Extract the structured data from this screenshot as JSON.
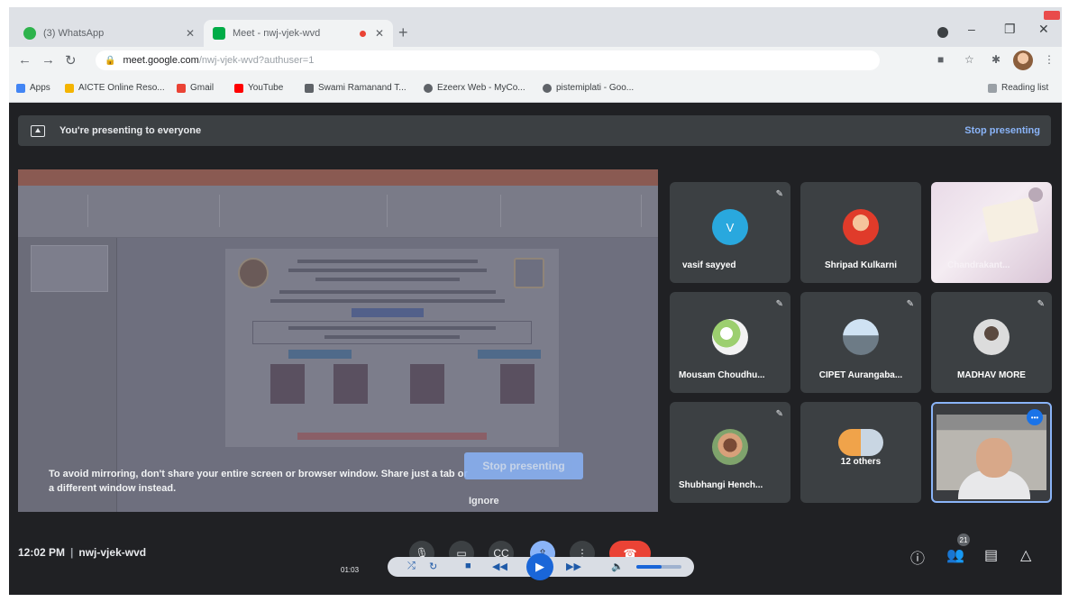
{
  "browser": {
    "tabs": [
      {
        "label": "(3) WhatsApp"
      },
      {
        "label": "Meet - nwj-vjek-wvd"
      }
    ],
    "new_tab": "+",
    "url": {
      "host": "meet.google.com",
      "path": "/nwj-vjek-wvd?authuser=1"
    },
    "bookmarks": [
      {
        "label": "Apps",
        "color": "#4285f4"
      },
      {
        "label": "AICTE Online Reso...",
        "color": "#f4b400"
      },
      {
        "label": "Gmail",
        "color": "#ea4335"
      },
      {
        "label": "YouTube",
        "color": "#ff0000"
      },
      {
        "label": "Swami Ramanand T...",
        "color": "#5f6368"
      },
      {
        "label": "Ezeerx Web - MyCo...",
        "color": "#5f6368"
      },
      {
        "label": "pistemiplati - Goo...",
        "color": "#5f6368"
      }
    ],
    "reading_list": "Reading list"
  },
  "meet": {
    "banner": {
      "text": "You're presenting to everyone",
      "stop_label": "Stop presenting"
    },
    "share_warning": "To avoid mirroring, don't share your entire screen or browser window. Share just a tab or a different window instead.",
    "stop_button": "Stop presenting",
    "ignore_button": "Ignore",
    "participants": [
      {
        "name": "vasif sayyed",
        "initial": "V"
      },
      {
        "name": "Shripad Kulkarni"
      },
      {
        "name": "Chandrakant..."
      },
      {
        "name": "Mousam Choudhu..."
      },
      {
        "name": "CIPET Aurangaba..."
      },
      {
        "name": "MADHAV MORE"
      },
      {
        "name": "Shubhangi Hench..."
      },
      {
        "name": "12 others"
      },
      {
        "name": ""
      }
    ],
    "meeting_time": "12:02 PM",
    "meeting_code": "nwj-vjek-wvd",
    "people_count": "21",
    "accent": "#8ab4f8",
    "hangup_color": "#ea4335"
  },
  "media": {
    "time": "01:03",
    "volume_level": 0.55
  }
}
